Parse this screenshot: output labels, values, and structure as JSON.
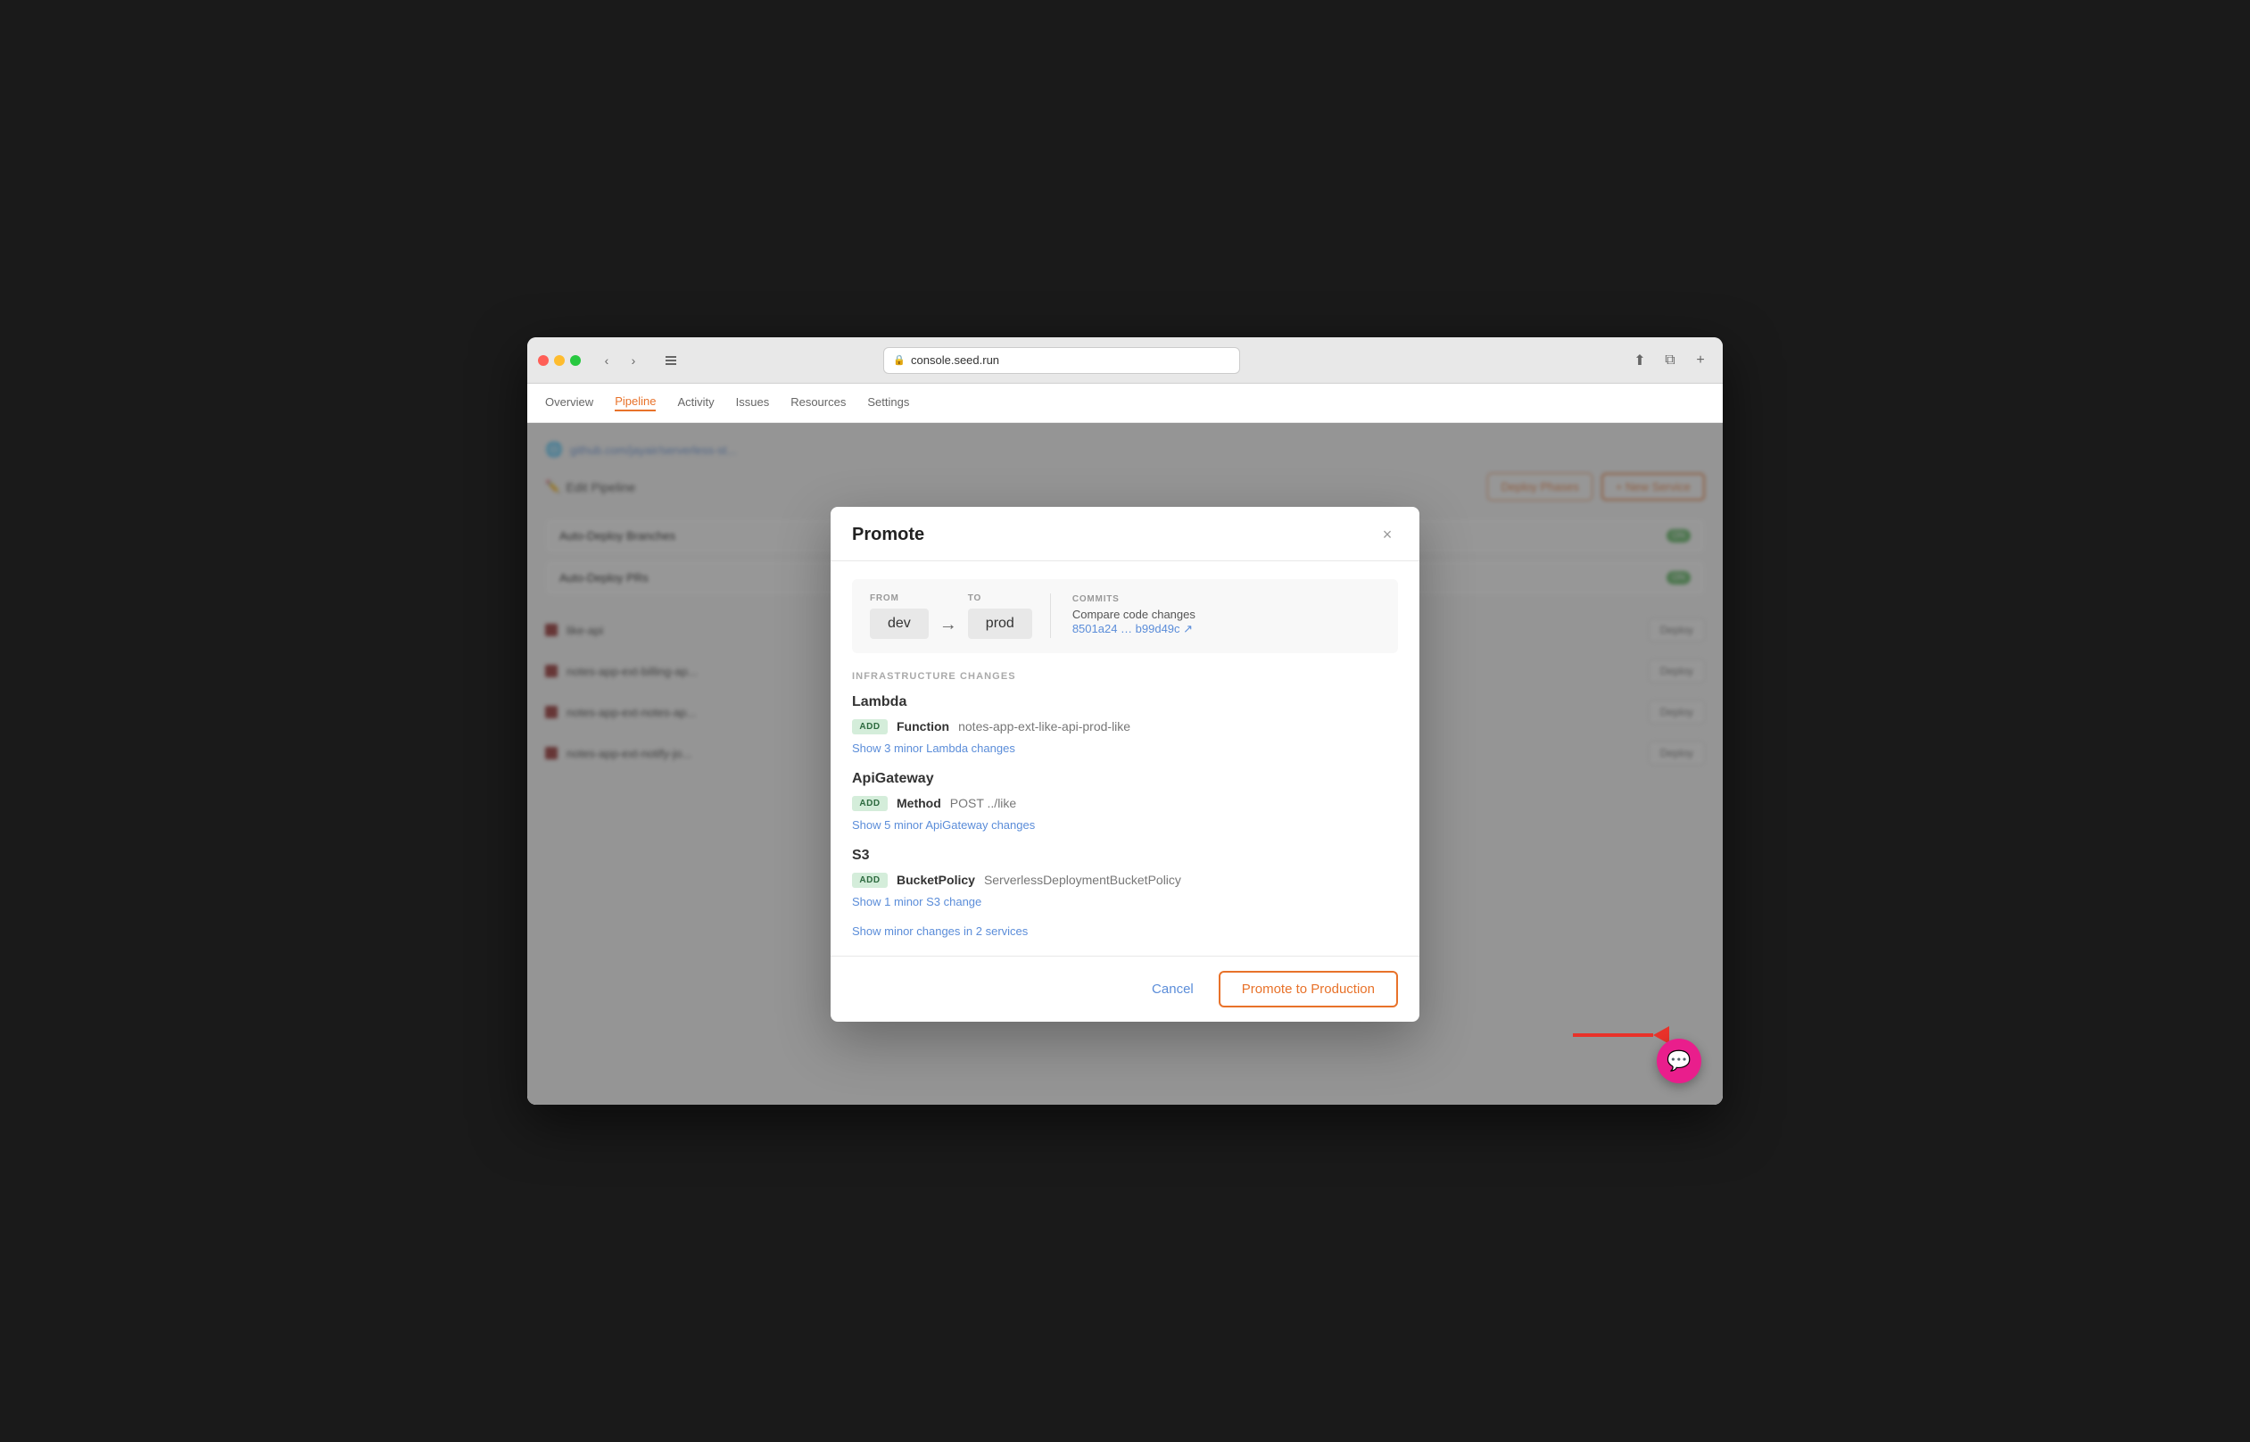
{
  "browser": {
    "url": "console.seed.run",
    "back_label": "‹",
    "forward_label": "›"
  },
  "nav": {
    "items": [
      {
        "label": "Overview",
        "active": false
      },
      {
        "label": "Pipeline",
        "active": true
      },
      {
        "label": "Activity",
        "active": false
      },
      {
        "label": "Issues",
        "active": false
      },
      {
        "label": "Resources",
        "active": false
      },
      {
        "label": "Settings",
        "active": false
      }
    ]
  },
  "background": {
    "breadcrumb": "github.com/jayair/serverless-st...",
    "edit_pipeline_label": "Edit Pipeline",
    "deploy_phases_label": "Deploy Phases",
    "new_service_label": "+ New Service",
    "auto_deploy_branches_label": "Auto-Deploy Branches",
    "auto_deploy_branches_value": "ON",
    "auto_deploy_prs_label": "Auto-Deploy PRs",
    "auto_deploy_prs_value": "ON",
    "services": [
      {
        "label": "like-api"
      },
      {
        "label": "notes-app-ext-billing-ap..."
      },
      {
        "label": "notes-app-ext-notes-ap..."
      },
      {
        "label": "notes-app-ext-notify-jo..."
      }
    ],
    "deploy_label": "Deploy"
  },
  "modal": {
    "title": "Promote",
    "close_label": "×",
    "from_label": "FROM",
    "to_label": "TO",
    "from_value": "dev",
    "to_value": "prod",
    "arrow_symbol": "→",
    "commits_label": "COMMITS",
    "commits_text": "Compare code changes",
    "commits_link": "8501a24 … b99d49c ↗",
    "infra_label": "INFRASTRUCTURE CHANGES",
    "groups": [
      {
        "name": "Lambda",
        "changes": [
          {
            "badge": "ADD",
            "type": "Function",
            "name": "notes-app-ext-like-api-prod-like"
          }
        ],
        "show_more_label": "Show 3 minor Lambda changes"
      },
      {
        "name": "ApiGateway",
        "changes": [
          {
            "badge": "ADD",
            "type": "Method",
            "name": "POST ../like"
          }
        ],
        "show_more_label": "Show 5 minor ApiGateway changes"
      },
      {
        "name": "S3",
        "changes": [
          {
            "badge": "ADD",
            "type": "BucketPolicy",
            "name": "ServerlessDeploymentBucketPolicy"
          }
        ],
        "show_more_label": "Show 1 minor S3 change"
      }
    ],
    "show_minor_services_label": "Show minor changes in 2 services",
    "cancel_label": "Cancel",
    "promote_label": "Promote to Production"
  }
}
